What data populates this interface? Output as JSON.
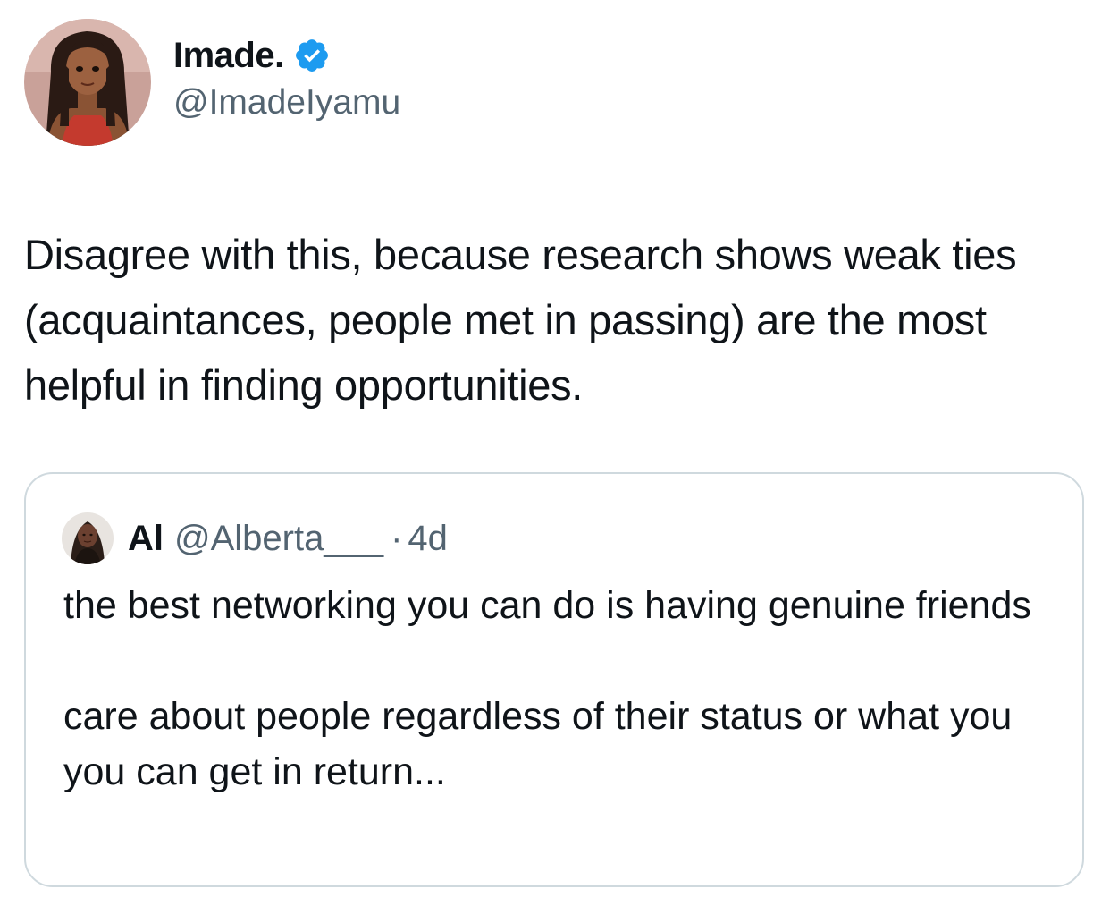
{
  "author": {
    "display_name": "Imade.",
    "handle": "@ImadeIyamu",
    "verified": true,
    "avatar_icon": "profile-avatar-illustration"
  },
  "tweet": {
    "text": "Disagree with this, because research shows weak ties (acquaintances, people met in passing) are the most helpful in finding opportunities."
  },
  "quoted_tweet": {
    "display_name": "Al",
    "handle": "@Alberta___",
    "separator": "·",
    "time": "4d",
    "avatar_icon": "profile-avatar-photo",
    "paragraphs": [
      "the best networking you can do is having genuine friends",
      "care about people regardless of their status or what you you can get in return..."
    ]
  },
  "colors": {
    "text": "#0f1419",
    "secondary": "#536471",
    "verified": "#1d9bf0",
    "border": "#cfd9de"
  }
}
